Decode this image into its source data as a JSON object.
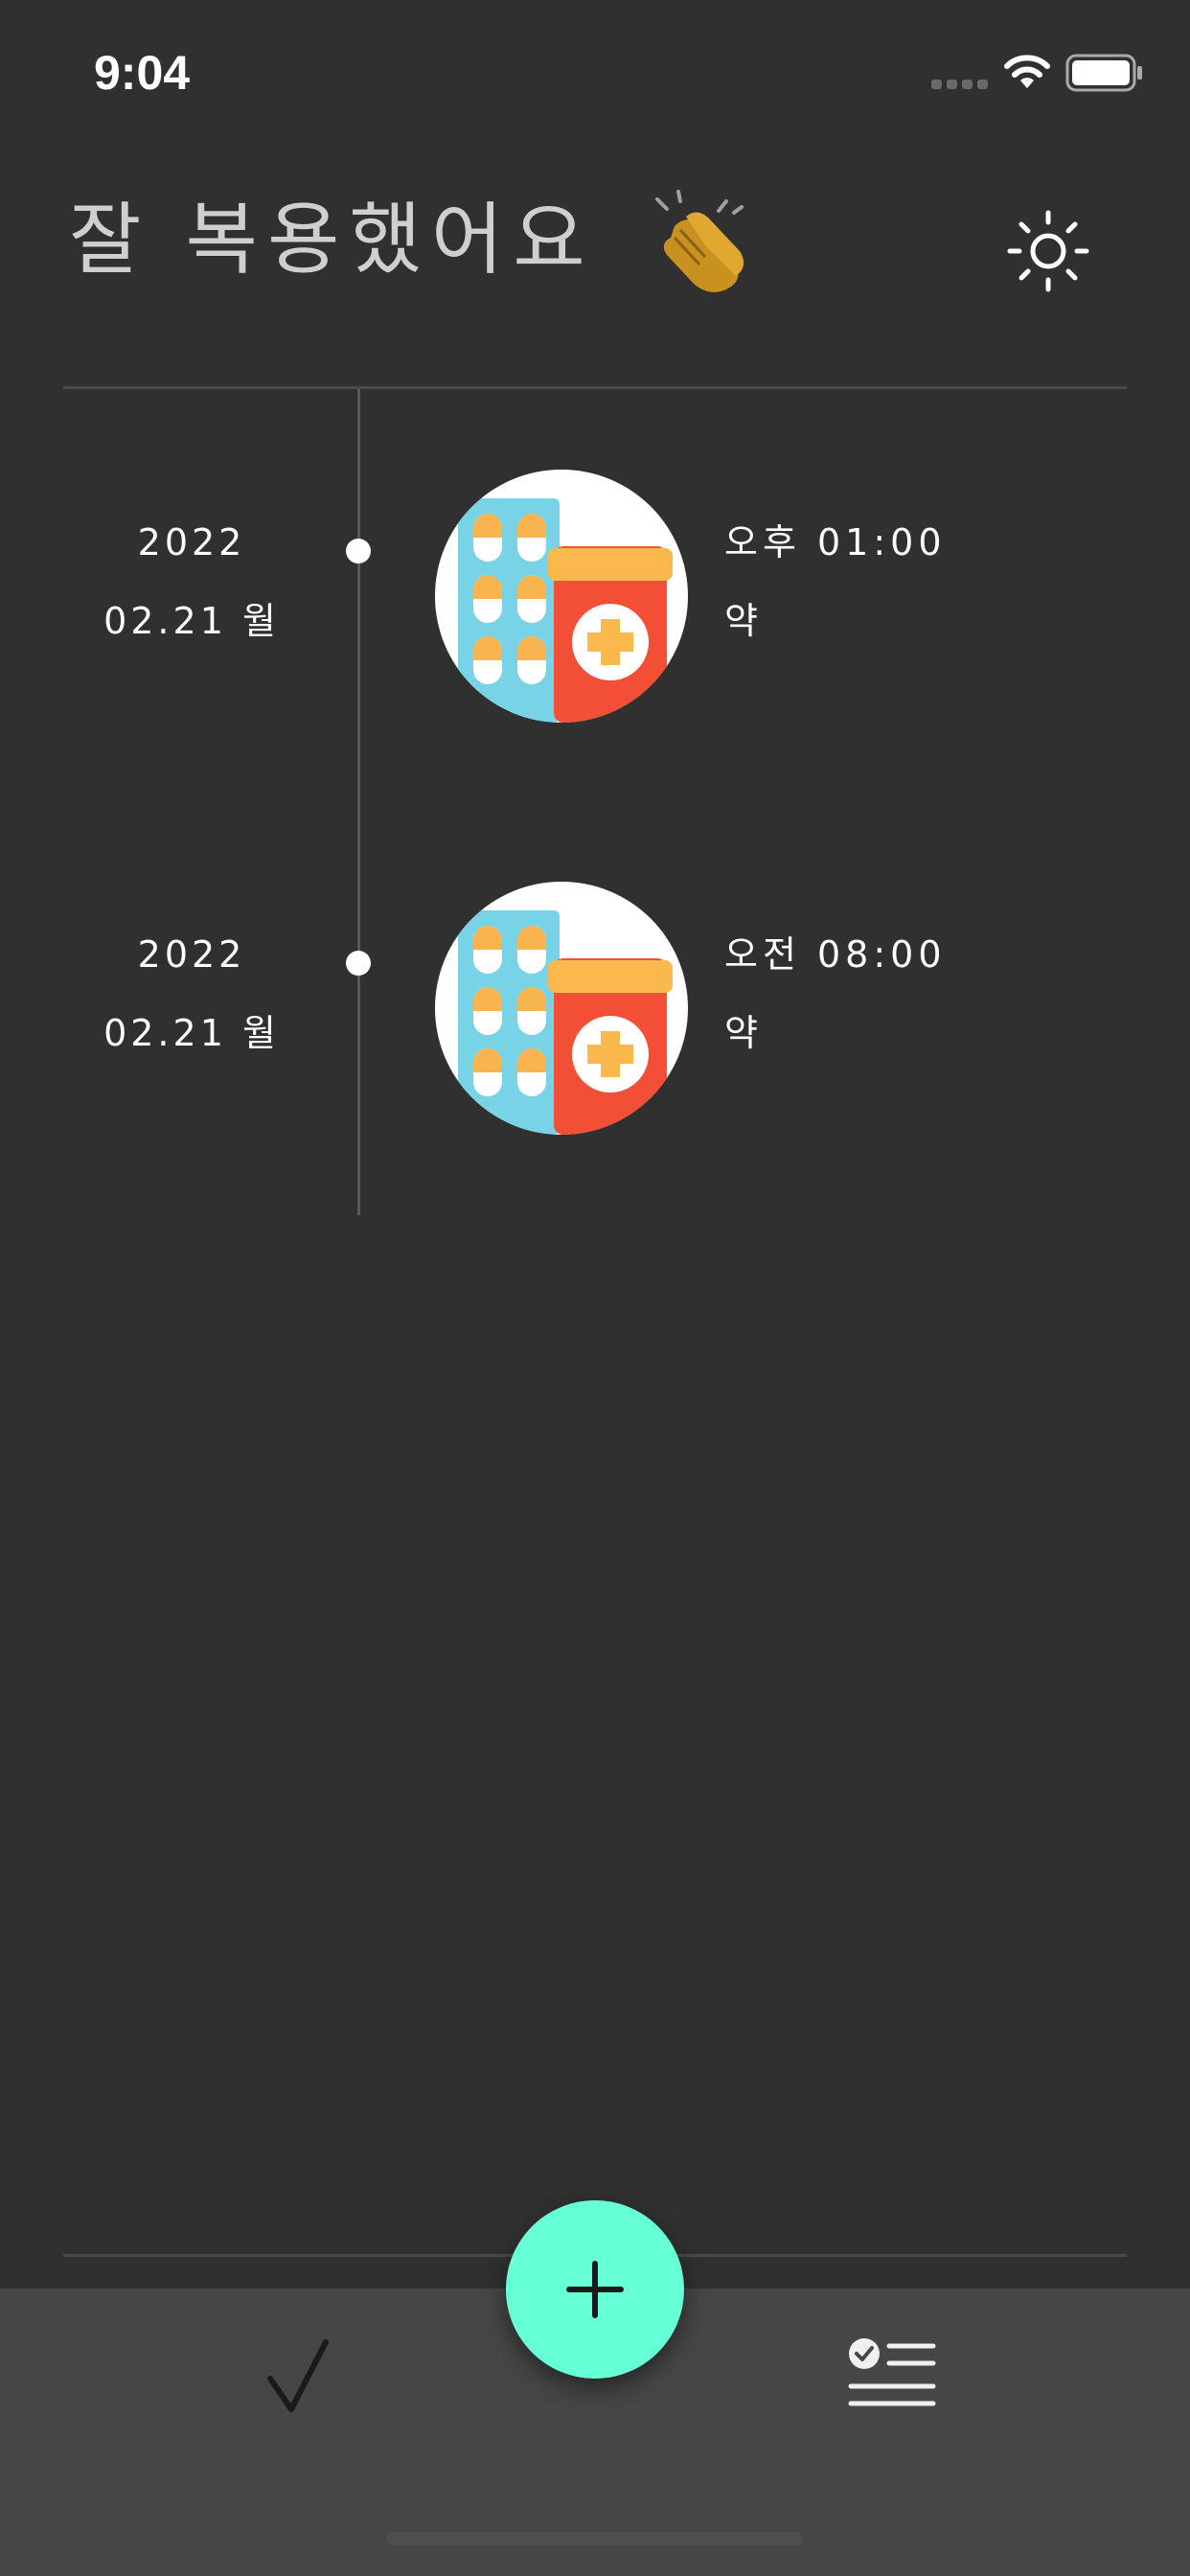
{
  "status_bar": {
    "time": "9:04"
  },
  "header": {
    "title": "잘 복용했어요",
    "title_icon": "clapping-hands-icon",
    "theme_icon": "sun-icon"
  },
  "timeline": {
    "entries": [
      {
        "year": "2022",
        "date": "02.21 월",
        "time": "오후 01:00",
        "name": "약",
        "image": "medicine-icon"
      },
      {
        "year": "2022",
        "date": "02.21 월",
        "time": "오전 08:00",
        "name": "약",
        "image": "medicine-icon"
      }
    ]
  },
  "tab_bar": {
    "left_icon": "checkmark-icon",
    "center_icon": "plus-icon",
    "right_icon": "checklist-icon"
  },
  "colors": {
    "background": "#303030",
    "tab_bar": "#464646",
    "accent": "#66ffd6",
    "title_text": "#cfcfcf"
  }
}
